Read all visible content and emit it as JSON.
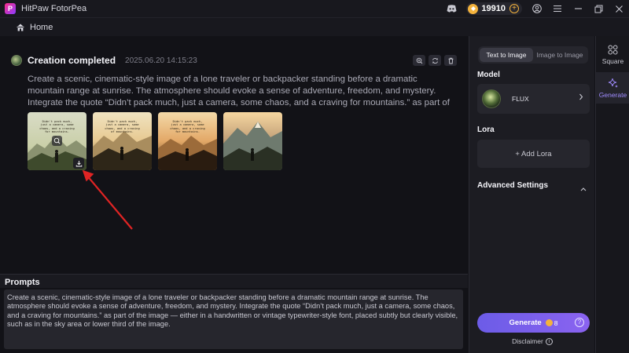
{
  "titlebar": {
    "app_title": "HitPaw FotorPea",
    "logo_letter": "P",
    "coins": "19910",
    "plus": "+"
  },
  "nav": {
    "home_label": "Home"
  },
  "creation": {
    "title": "Creation completed",
    "timestamp": "2025.06.20  14:15:23",
    "prompt_preview": "Create a scenic, cinematic-style image of a lone traveler or backpacker standing before a dramatic mountain range at sunrise. The atmosphere should evoke a sense of adventure, freedom, and mystery. Integrate the quote “Didn’t pack much, just a camera, some chaos, and a craving for mountains.” as part of the image — either in a handwritten or vintage typewr…",
    "thumb_quote_a": "Didn't pack much, just a camera, some chaos, and a craving for mountains.",
    "thumb_quote_b": "Didn't pack much, just a camera, some chaos, and a craving of mountains.",
    "thumb_quote_c": "Didn't pack much, just a camera, some chaos, and a craving for mountains."
  },
  "prompts": {
    "label": "Prompts",
    "text": "Create a scenic, cinematic-style image of a lone traveler or backpacker standing before a dramatic mountain range at sunrise. The atmosphere should evoke a sense of adventure, freedom, and mystery. Integrate the quote “Didn’t pack much, just a camera, some chaos, and a craving for mountains.” as part of the image — either in a handwritten or vintage typewriter-style font, placed subtly but clearly visible, such as in the sky area or lower third of the image."
  },
  "panel": {
    "tabs": [
      "Text to Image",
      "Image to Image"
    ],
    "model_label": "Model",
    "model_name": "FLUX",
    "lora_label": "Lora",
    "add_lora": "+ Add Lora",
    "advanced_label": "Advanced Settings",
    "generate_label": "Generate",
    "generate_cost": "8",
    "help": "?",
    "disclaimer": "Disclaimer",
    "info": "i"
  },
  "rail": {
    "square_label": "Square",
    "generate_label": "Generate"
  },
  "colors": {
    "accent": "#7b61ff",
    "coin": "#f3b23c",
    "annotation_arrow": "#e02424"
  }
}
